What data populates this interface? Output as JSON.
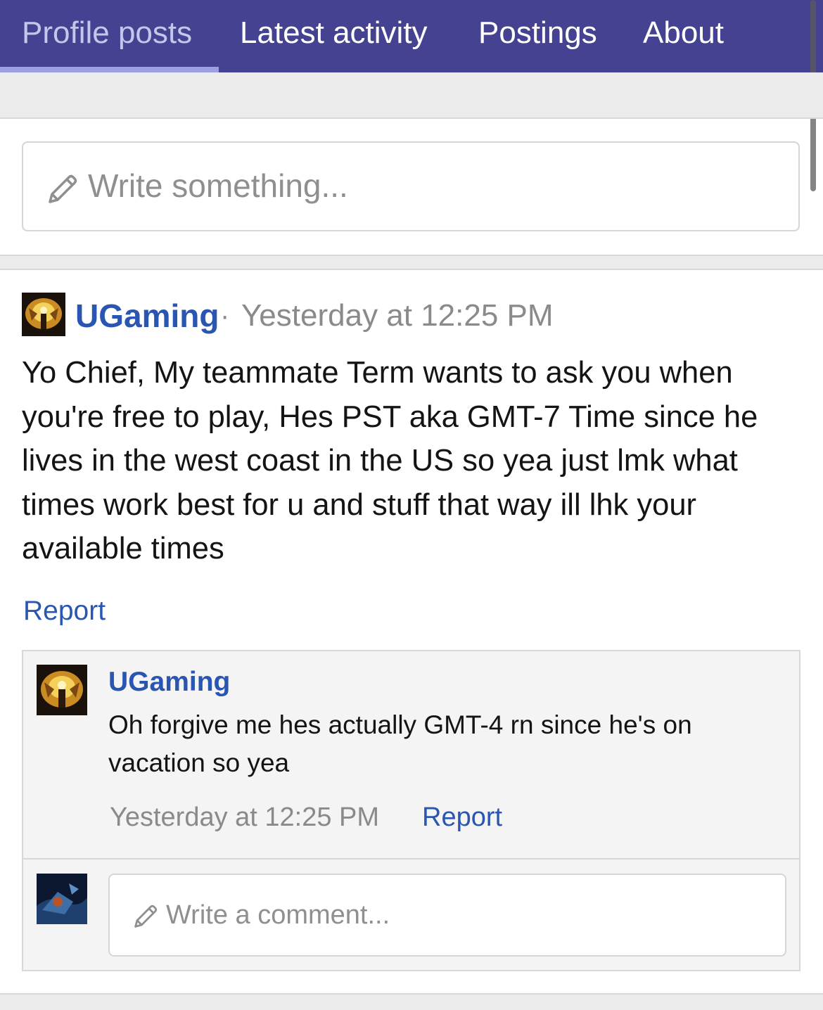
{
  "tabs": [
    {
      "label": "Profile posts",
      "active": true
    },
    {
      "label": "Latest activity",
      "active": false
    },
    {
      "label": "Postings",
      "active": false
    },
    {
      "label": "About",
      "active": false
    }
  ],
  "composer": {
    "placeholder": "Write something...",
    "icon": "pencil-icon"
  },
  "post": {
    "author": "UGaming",
    "separator": "·",
    "time": "Yesterday at 12:25 PM",
    "body": "Yo Chief, My teammate Term wants to ask you when you're free to play, Hes PST aka GMT-7 Time since he lives in the west coast in the US so yea just lmk what times work best for u and stuff that way ill lhk your available times",
    "report_label": "Report"
  },
  "comment": {
    "author": "UGaming",
    "body": "Oh forgive me hes actually GMT-4 rn since he's on vacation so yea",
    "time": "Yesterday at 12:25 PM",
    "report_label": "Report"
  },
  "comment_composer": {
    "placeholder": "Write a comment...",
    "icon": "pencil-icon"
  },
  "colors": {
    "header": "#454291",
    "link": "#2a55b1",
    "muted": "#8a8a8a"
  }
}
